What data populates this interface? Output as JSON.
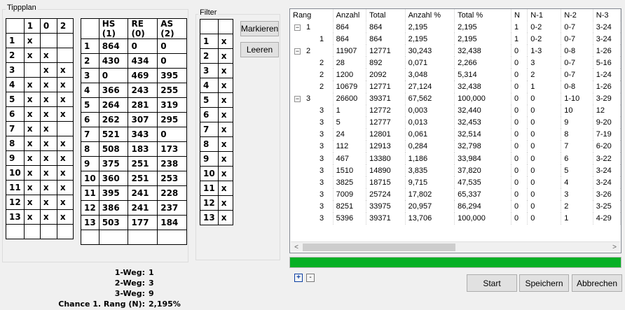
{
  "tippplan": {
    "title": "Tippplan",
    "grid1_header": [
      "",
      "1",
      "0",
      "2"
    ],
    "grid1_rows": [
      [
        "1",
        "x",
        "",
        ""
      ],
      [
        "2",
        "x",
        "x",
        ""
      ],
      [
        "3",
        "",
        "x",
        "x"
      ],
      [
        "4",
        "x",
        "x",
        "x"
      ],
      [
        "5",
        "x",
        "x",
        "x"
      ],
      [
        "6",
        "x",
        "x",
        "x"
      ],
      [
        "7",
        "x",
        "x",
        ""
      ],
      [
        "8",
        "x",
        "x",
        "x"
      ],
      [
        "9",
        "x",
        "x",
        "x"
      ],
      [
        "10",
        "x",
        "x",
        "x"
      ],
      [
        "11",
        "x",
        "x",
        "x"
      ],
      [
        "12",
        "x",
        "x",
        "x"
      ],
      [
        "13",
        "x",
        "x",
        "x"
      ],
      [
        "",
        "",
        "",
        ""
      ]
    ],
    "grid2_header": [
      "",
      "HS (1)",
      "RE (0)",
      "AS (2)"
    ],
    "grid2_rows": [
      [
        "1",
        "864",
        "0",
        "0"
      ],
      [
        "2",
        "430",
        "434",
        "0"
      ],
      [
        "3",
        "0",
        "469",
        "395"
      ],
      [
        "4",
        "366",
        "243",
        "255"
      ],
      [
        "5",
        "264",
        "281",
        "319"
      ],
      [
        "6",
        "262",
        "307",
        "295"
      ],
      [
        "7",
        "521",
        "343",
        "0"
      ],
      [
        "8",
        "508",
        "183",
        "173"
      ],
      [
        "9",
        "375",
        "251",
        "238"
      ],
      [
        "10",
        "360",
        "251",
        "253"
      ],
      [
        "11",
        "395",
        "241",
        "228"
      ],
      [
        "12",
        "386",
        "241",
        "237"
      ],
      [
        "13",
        "503",
        "177",
        "184"
      ],
      [
        "",
        "",
        "",
        ""
      ]
    ]
  },
  "filter": {
    "title": "Filter",
    "grid_header": [
      "",
      ""
    ],
    "grid_rows": [
      [
        "1",
        "x"
      ],
      [
        "2",
        "x"
      ],
      [
        "3",
        "x"
      ],
      [
        "4",
        "x"
      ],
      [
        "5",
        "x"
      ],
      [
        "6",
        "x"
      ],
      [
        "7",
        "x"
      ],
      [
        "8",
        "x"
      ],
      [
        "9",
        "x"
      ],
      [
        "10",
        "x"
      ],
      [
        "11",
        "x"
      ],
      [
        "12",
        "x"
      ],
      [
        "13",
        "x"
      ]
    ],
    "mark_label": "Markieren",
    "clear_label": "Leeren"
  },
  "results": {
    "columns": [
      "Rang",
      "Anzahl",
      "Total",
      "Anzahl %",
      "Total %",
      "N",
      "N-1",
      "N-2",
      "N-3"
    ],
    "rows": [
      {
        "level": 0,
        "expander": "−",
        "rang": "1",
        "cells": [
          "864",
          "864",
          "2,195",
          "2,195",
          "1",
          "0-2",
          "0-7",
          "3-24"
        ]
      },
      {
        "level": 1,
        "expander": "",
        "rang": "1",
        "cells": [
          "864",
          "864",
          "2,195",
          "2,195",
          "1",
          "0-2",
          "0-7",
          "3-24"
        ]
      },
      {
        "level": 0,
        "expander": "−",
        "rang": "2",
        "cells": [
          "11907",
          "12771",
          "30,243",
          "32,438",
          "0",
          "1-3",
          "0-8",
          "1-26"
        ]
      },
      {
        "level": 1,
        "expander": "",
        "rang": "2",
        "cells": [
          "28",
          "892",
          "0,071",
          "2,266",
          "0",
          "3",
          "0-7",
          "5-16"
        ]
      },
      {
        "level": 1,
        "expander": "",
        "rang": "2",
        "cells": [
          "1200",
          "2092",
          "3,048",
          "5,314",
          "0",
          "2",
          "0-7",
          "1-24"
        ]
      },
      {
        "level": 1,
        "expander": "",
        "rang": "2",
        "cells": [
          "10679",
          "12771",
          "27,124",
          "32,438",
          "0",
          "1",
          "0-8",
          "1-26"
        ]
      },
      {
        "level": 0,
        "expander": "−",
        "rang": "3",
        "cells": [
          "26600",
          "39371",
          "67,562",
          "100,000",
          "0",
          "0",
          "1-10",
          "3-29"
        ]
      },
      {
        "level": 1,
        "expander": "",
        "rang": "3",
        "cells": [
          "1",
          "12772",
          "0,003",
          "32,440",
          "0",
          "0",
          "10",
          "12"
        ]
      },
      {
        "level": 1,
        "expander": "",
        "rang": "3",
        "cells": [
          "5",
          "12777",
          "0,013",
          "32,453",
          "0",
          "0",
          "9",
          "9-20"
        ]
      },
      {
        "level": 1,
        "expander": "",
        "rang": "3",
        "cells": [
          "24",
          "12801",
          "0,061",
          "32,514",
          "0",
          "0",
          "8",
          "7-19"
        ]
      },
      {
        "level": 1,
        "expander": "",
        "rang": "3",
        "cells": [
          "112",
          "12913",
          "0,284",
          "32,798",
          "0",
          "0",
          "7",
          "6-20"
        ]
      },
      {
        "level": 1,
        "expander": "",
        "rang": "3",
        "cells": [
          "467",
          "13380",
          "1,186",
          "33,984",
          "0",
          "0",
          "6",
          "3-22"
        ]
      },
      {
        "level": 1,
        "expander": "",
        "rang": "3",
        "cells": [
          "1510",
          "14890",
          "3,835",
          "37,820",
          "0",
          "0",
          "5",
          "3-24"
        ]
      },
      {
        "level": 1,
        "expander": "",
        "rang": "3",
        "cells": [
          "3825",
          "18715",
          "9,715",
          "47,535",
          "0",
          "0",
          "4",
          "3-24"
        ]
      },
      {
        "level": 1,
        "expander": "",
        "rang": "3",
        "cells": [
          "7009",
          "25724",
          "17,802",
          "65,337",
          "0",
          "0",
          "3",
          "3-26"
        ]
      },
      {
        "level": 1,
        "expander": "",
        "rang": "3",
        "cells": [
          "8251",
          "33975",
          "20,957",
          "86,294",
          "0",
          "0",
          "2",
          "3-25"
        ]
      },
      {
        "level": 1,
        "expander": "",
        "rang": "3",
        "cells": [
          "5396",
          "39371",
          "13,706",
          "100,000",
          "0",
          "0",
          "1",
          "4-29"
        ]
      }
    ],
    "scroll_left_icon": "<",
    "scroll_right_icon": ">"
  },
  "progress": {
    "value": 1.0,
    "color": "#06b025"
  },
  "tree_controls": {
    "expand_label": "+",
    "collapse_label": "-"
  },
  "summary": {
    "items": [
      {
        "label": "1-Weg:",
        "value": "1"
      },
      {
        "label": "2-Weg:",
        "value": "3"
      },
      {
        "label": "3-Weg:",
        "value": "9"
      },
      {
        "label": "Chance 1. Rang (N):",
        "value": "2,195%"
      }
    ]
  },
  "actions": {
    "start_label": "Start",
    "save_label": "Speichern",
    "cancel_label": "Abbrechen"
  }
}
